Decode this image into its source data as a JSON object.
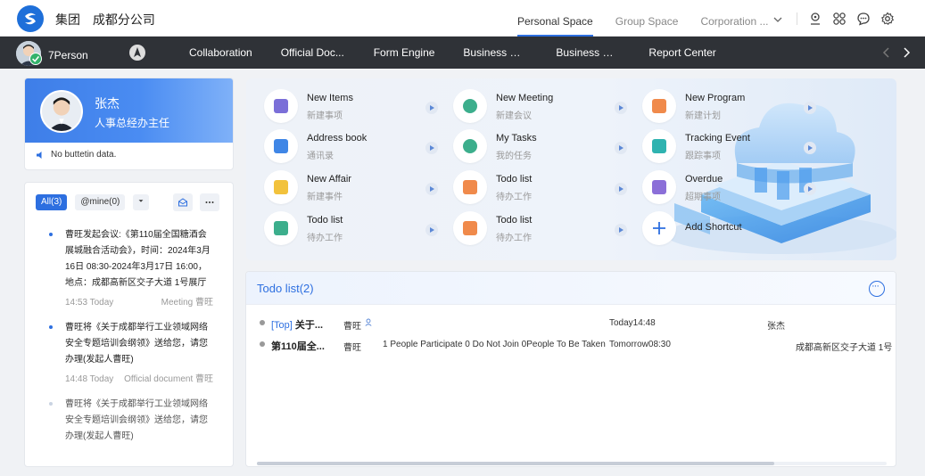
{
  "header": {
    "org_name": "集团",
    "branch": "成都分公司",
    "tabs": [
      {
        "label": "Personal Space",
        "active": true
      },
      {
        "label": "Group Space"
      },
      {
        "label": "Corporation ..."
      }
    ],
    "icons": [
      "location-icon",
      "apps-icon",
      "chat-icon",
      "settings-icon"
    ]
  },
  "nav": {
    "user": "7Person",
    "items": [
      "Collaboration",
      "Official Doc...",
      "Form Engine",
      "Business So...",
      "Business Or...",
      "Report Center"
    ]
  },
  "profile": {
    "name": "张杰",
    "title": "人事总经办主任",
    "bulletin": "No buttetin data."
  },
  "feed": {
    "tabs": {
      "all": "All(3)",
      "mine": "@mine(0)"
    },
    "items": [
      {
        "text": "曹旺发起会议:《第110届全国糖酒会展城融合活动会》，时间：2024年3月16日 08:30-2024年3月17日 16:00，地点：成都高新区交子大道 1号展厅",
        "time": "14:53 Today",
        "source": "Meeting 曹旺"
      },
      {
        "text": "曹旺将《关于成都举行工业领域网络安全专题培训会纲领》送给您，请您办理(发起人曹旺)",
        "time": "14:48 Today",
        "source": "Official document 曹旺"
      },
      {
        "text": "曹旺将《关于成都举行工业领域网络安全专题培训会纲领》送给您，请您办理(发起人曹旺)",
        "time": "",
        "source": ""
      }
    ]
  },
  "shortcuts": [
    {
      "title": "New Items",
      "sub": "新建事项",
      "color": "#7b6fd8"
    },
    {
      "title": "New Meeting",
      "sub": "新建会议",
      "color": "#3cae8c"
    },
    {
      "title": "New Program",
      "sub": "新建计划",
      "color": "#f08a4b"
    },
    {
      "title": "Address book",
      "sub": "通讯录",
      "color": "#3f86e6"
    },
    {
      "title": "My Tasks",
      "sub": "我的任务",
      "color": "#3cae8c"
    },
    {
      "title": "Tracking Event",
      "sub": "跟踪事项",
      "color": "#2fb3b0"
    },
    {
      "title": "New Affair",
      "sub": "新建事件",
      "color": "#f2c23c"
    },
    {
      "title": "Todo list",
      "sub": "待办工作",
      "color": "#f08a4b"
    },
    {
      "title": "Overdue",
      "sub": "超期事项",
      "color": "#8b6fd8"
    },
    {
      "title": "Todo list",
      "sub": "待办工作",
      "color": "#3cae8c"
    },
    {
      "title": "Todo list",
      "sub": "待办工作",
      "color": "#f08a4b"
    },
    {
      "title": "Add Shortcut",
      "sub": "",
      "color": "#2d6fe0"
    }
  ],
  "todo": {
    "title": "Todo list(2)",
    "rows": [
      {
        "top_tag": "[Top]",
        "subject": "关于...",
        "sender": "曹旺",
        "desc": "",
        "time": "Today14:48",
        "person": "张杰",
        "addr": ""
      },
      {
        "top_tag": "",
        "subject": "第110届全...",
        "sender": "曹旺",
        "desc": "1 People Participate 0 Do Not Join 0People To Be Taken",
        "time": "Tomorrow08:30",
        "person": "",
        "addr": "成都高新区交子大道 1号"
      }
    ]
  }
}
